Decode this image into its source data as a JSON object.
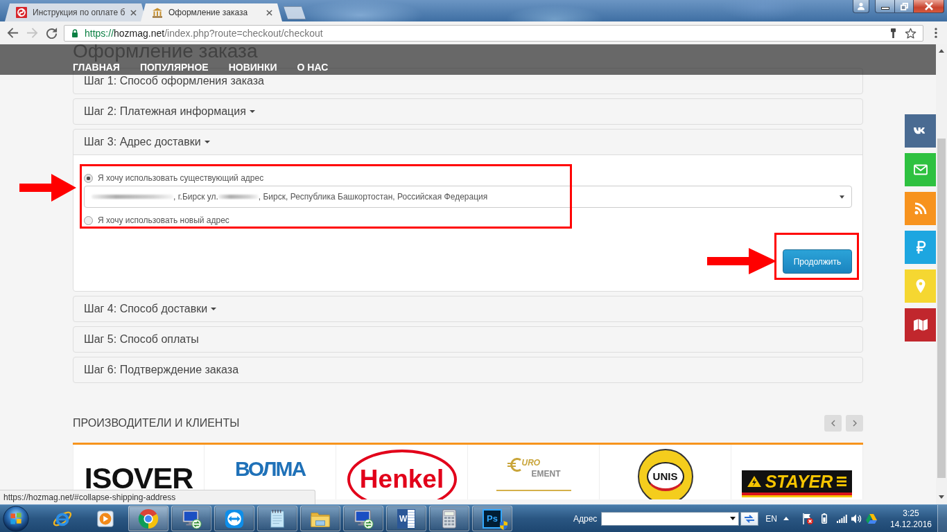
{
  "browser": {
    "tabs": [
      {
        "title": "Инструкция по оплате б",
        "selected": false
      },
      {
        "title": "Оформление заказа",
        "selected": true
      }
    ],
    "nav_buttons": [
      {
        "kind": "back",
        "disabled": false
      },
      {
        "kind": "forward",
        "disabled": true
      },
      {
        "kind": "reload",
        "disabled": false
      }
    ],
    "address_bar": {
      "scheme": "https://",
      "host": "hozmag.net",
      "path": "/index.php?route=checkout/checkout"
    },
    "status_url": "https://hozmag.net/#collapse-shipping-address"
  },
  "site": {
    "heading": "Оформление заказа",
    "menu": [
      "ГЛАВНАЯ",
      "ПОПУЛЯРНОЕ",
      "НОВИНКИ",
      "О НАС"
    ]
  },
  "checkout_steps": [
    {
      "title": "Шаг 1: Способ оформления заказа",
      "caret": false,
      "expanded": false
    },
    {
      "title": "Шаг 2: Платежная информация",
      "caret": true,
      "expanded": false
    },
    {
      "title": "Шаг 3: Адрес доставки",
      "caret": true,
      "expanded": true,
      "address_form": {
        "highlighted": true,
        "options": [
          {
            "label": "Я хочу использовать существующий адрес",
            "selected": true,
            "address_select": [
              {
                "kind": "redacted"
              },
              {
                "kind": "text",
                "text": ", г.Бирск ул."
              },
              {
                "kind": "redacted"
              },
              {
                "kind": "text",
                "text": ", Бирск, Республика Башкортостан, Российская Федерация"
              }
            ]
          },
          {
            "label": "Я хочу использовать новый адрес",
            "selected": false
          }
        ],
        "continue_button": {
          "label": "Продолжить",
          "highlighted": true
        }
      }
    },
    {
      "title": "Шаг 4: Способ доставки",
      "caret": true,
      "expanded": false
    },
    {
      "title": "Шаг 5: Способ оплаты",
      "caret": false,
      "expanded": false
    },
    {
      "title": "Шаг 6: Подтверждение заказа",
      "caret": false,
      "expanded": false
    }
  ],
  "social_links": [
    {
      "kind": "vk",
      "color": "#4a6b92"
    },
    {
      "kind": "email",
      "color": "#2ec140"
    },
    {
      "kind": "rss",
      "color": "#f7931e"
    },
    {
      "kind": "ruble",
      "color": "#1da6e0"
    },
    {
      "kind": "location",
      "color": "#f5d731"
    },
    {
      "kind": "map",
      "color": "#c1272d"
    }
  ],
  "manufacturers": {
    "title": "ПРОИЗВОДИТЕЛИ И КЛИЕНТЫ",
    "logos": [
      {
        "kind": "isover",
        "text": "ISOVER"
      },
      {
        "kind": "volma",
        "text": "ВОЛМА"
      },
      {
        "kind": "henkel",
        "text": "Henkel"
      },
      {
        "kind": "euro-cement",
        "lines": [
          "URO",
          "EMENT"
        ]
      },
      {
        "kind": "unis",
        "text": "UNIS"
      },
      {
        "kind": "stayer",
        "text": "STAYER"
      }
    ]
  },
  "taskbar": {
    "apps": [
      {
        "kind": "ie",
        "running": false,
        "selected": false
      },
      {
        "kind": "media-player",
        "running": false,
        "selected": false
      },
      {
        "kind": "chrome",
        "running": true,
        "selected": true
      },
      {
        "kind": "remote-desktop",
        "running": true,
        "selected": false
      },
      {
        "kind": "teamviewer",
        "running": true,
        "selected": false
      },
      {
        "kind": "notepad",
        "running": true,
        "selected": false
      },
      {
        "kind": "explorer",
        "running": true,
        "selected": false
      },
      {
        "kind": "remote-desktop",
        "running": true,
        "selected": false
      },
      {
        "kind": "word",
        "running": true,
        "selected": false,
        "glyph": "W"
      },
      {
        "kind": "calculator",
        "running": true,
        "selected": false
      },
      {
        "kind": "photoshop",
        "running": true,
        "selected": false,
        "glyph": "Ps"
      }
    ],
    "address_toolbar": {
      "label": "Адрес"
    },
    "language": "EN",
    "clock": {
      "time": "3:25",
      "date": "14.12.2016"
    }
  }
}
